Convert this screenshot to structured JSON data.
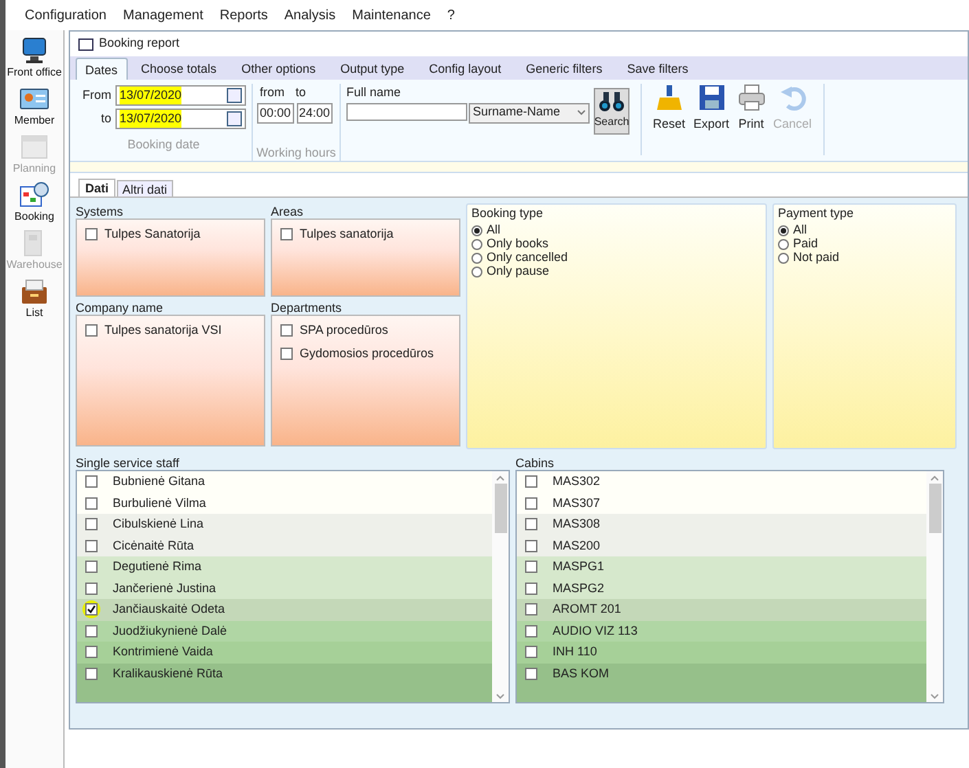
{
  "menu": [
    "Configuration",
    "Management",
    "Reports",
    "Analysis",
    "Maintenance",
    "?"
  ],
  "sidebar": {
    "items": [
      {
        "label": "Front office",
        "kind": "monitor",
        "disabled": false
      },
      {
        "label": "Member",
        "kind": "card",
        "disabled": false
      },
      {
        "label": "Planning",
        "kind": "calendar",
        "disabled": true
      },
      {
        "label": "Booking",
        "kind": "clock",
        "disabled": false
      },
      {
        "label": "Warehouse",
        "kind": "shelf",
        "disabled": true
      },
      {
        "label": "List",
        "kind": "box",
        "disabled": false
      }
    ]
  },
  "window": {
    "title": "Booking report"
  },
  "tabs": [
    {
      "label": "Dates",
      "selected": true
    },
    {
      "label": "Choose totals",
      "selected": false
    },
    {
      "label": "Other options",
      "selected": false
    },
    {
      "label": "Output type",
      "selected": false
    },
    {
      "label": "Config layout",
      "selected": false
    },
    {
      "label": "Generic filters",
      "selected": false
    },
    {
      "label": "Save filters",
      "selected": false
    }
  ],
  "booking_date": {
    "caption": "Booking date",
    "from_label": "From",
    "from": "13/07/2020",
    "from_highlighted": true,
    "to_label": "to",
    "to": "13/07/2020",
    "to_highlighted": true
  },
  "working_hours": {
    "caption": "Working hours",
    "from_label": "from",
    "from": "00:00",
    "to_label": "to",
    "to": "24:00"
  },
  "full_name": {
    "label": "Full name",
    "order": "Surname-Name",
    "search": "Search"
  },
  "actions": [
    {
      "label": "Reset",
      "kind": "reset",
      "disabled": false
    },
    {
      "label": "Export",
      "kind": "export",
      "disabled": false
    },
    {
      "label": "Print",
      "kind": "print",
      "disabled": false
    },
    {
      "label": "Cancel",
      "kind": "cancel",
      "disabled": true
    }
  ],
  "sub_tabs": [
    {
      "label": "Dati",
      "selected": true
    },
    {
      "label": "Altri dati",
      "selected": false
    }
  ],
  "systems": {
    "title": "Systems",
    "items": [
      {
        "label": "Tulpes Sanatorija",
        "checked": false
      }
    ]
  },
  "areas": {
    "title": "Areas",
    "items": [
      {
        "label": "Tulpes sanatorija",
        "checked": false
      }
    ]
  },
  "company_name": {
    "title": "Company name",
    "items": [
      {
        "label": "Tulpes sanatorija VSI",
        "checked": false
      }
    ]
  },
  "departments": {
    "title": "Departments",
    "items": [
      {
        "label": "SPA procedūros",
        "checked": false
      },
      {
        "label": "Gydomosios procedūros",
        "checked": false
      }
    ]
  },
  "booking_type": {
    "title": "Booking type",
    "options": [
      {
        "label": "All",
        "selected": true
      },
      {
        "label": "Only books",
        "selected": false
      },
      {
        "label": "Only cancelled",
        "selected": false
      },
      {
        "label": "Only pause",
        "selected": false
      }
    ]
  },
  "payment_type": {
    "title": "Payment type",
    "options": [
      {
        "label": "All",
        "selected": true
      },
      {
        "label": "Paid",
        "selected": false
      },
      {
        "label": "Not paid",
        "selected": false
      }
    ]
  },
  "single_service_staff": {
    "title": "Single service staff",
    "items": [
      {
        "label": "Bubnienė Gitana",
        "checked": false,
        "highlighted": false
      },
      {
        "label": "Burbulienė Vilma",
        "checked": false,
        "highlighted": false
      },
      {
        "label": "Cibulskienė Lina",
        "checked": false,
        "highlighted": false
      },
      {
        "label": "Cicėnaitė Rūta",
        "checked": false,
        "highlighted": false
      },
      {
        "label": "Degutienė Rima",
        "checked": false,
        "highlighted": false
      },
      {
        "label": "Jančerienė Justina",
        "checked": false,
        "highlighted": false
      },
      {
        "label": "Jančiauskaitė Odeta",
        "checked": true,
        "highlighted": true
      },
      {
        "label": "Juodžiukynienė Dalė",
        "checked": false,
        "highlighted": false
      },
      {
        "label": "Kontrimienė Vaida",
        "checked": false,
        "highlighted": false
      },
      {
        "label": "Kralikauskienė Rūta",
        "checked": false,
        "highlighted": false
      }
    ]
  },
  "cabins": {
    "title": "Cabins",
    "items": [
      {
        "label": "MAS302",
        "checked": false,
        "highlighted": false
      },
      {
        "label": "MAS307",
        "checked": false,
        "highlighted": false
      },
      {
        "label": "MAS308",
        "checked": false,
        "highlighted": false
      },
      {
        "label": "MAS200",
        "checked": false,
        "highlighted": false
      },
      {
        "label": "MASPG1",
        "checked": false,
        "highlighted": false
      },
      {
        "label": "MASPG2",
        "checked": false,
        "highlighted": false
      },
      {
        "label": "AROMT 201",
        "checked": false,
        "highlighted": false
      },
      {
        "label": "AUDIO VIZ 113",
        "checked": false,
        "highlighted": false
      },
      {
        "label": "INH 110",
        "checked": false,
        "highlighted": false
      },
      {
        "label": "BAS KOM",
        "checked": false,
        "highlighted": false
      }
    ]
  }
}
